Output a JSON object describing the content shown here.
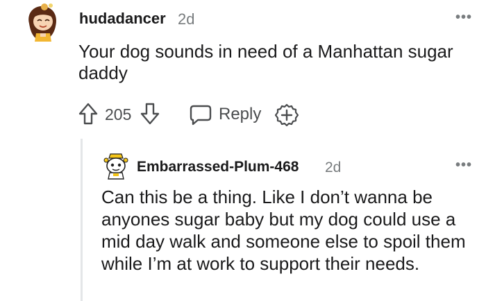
{
  "comment": {
    "username": "hudadancer",
    "time": "2d",
    "more": "•••",
    "body": "Your dog sounds in need of a Manhattan sugar daddy",
    "actions": {
      "score": "205",
      "reply_label": "Reply"
    }
  },
  "reply": {
    "username": "Embarrassed-Plum-468",
    "time": "2d",
    "more": "•••",
    "body": "Can this be a thing. Like I don’t wanna be anyones sugar baby but my dog could use a mid day walk and someone else to spoil them while I’m at work to support their needs."
  },
  "colors": {
    "text": "#1a1a1b",
    "meta": "#787c7e",
    "icon": "#4a4c4e",
    "thread_line": "#e4e6e8"
  },
  "icons": [
    "avatar-hudadancer",
    "more-options-icon",
    "upvote-icon",
    "downvote-icon",
    "reply-icon",
    "award-icon",
    "avatar-embarrassed-plum"
  ]
}
